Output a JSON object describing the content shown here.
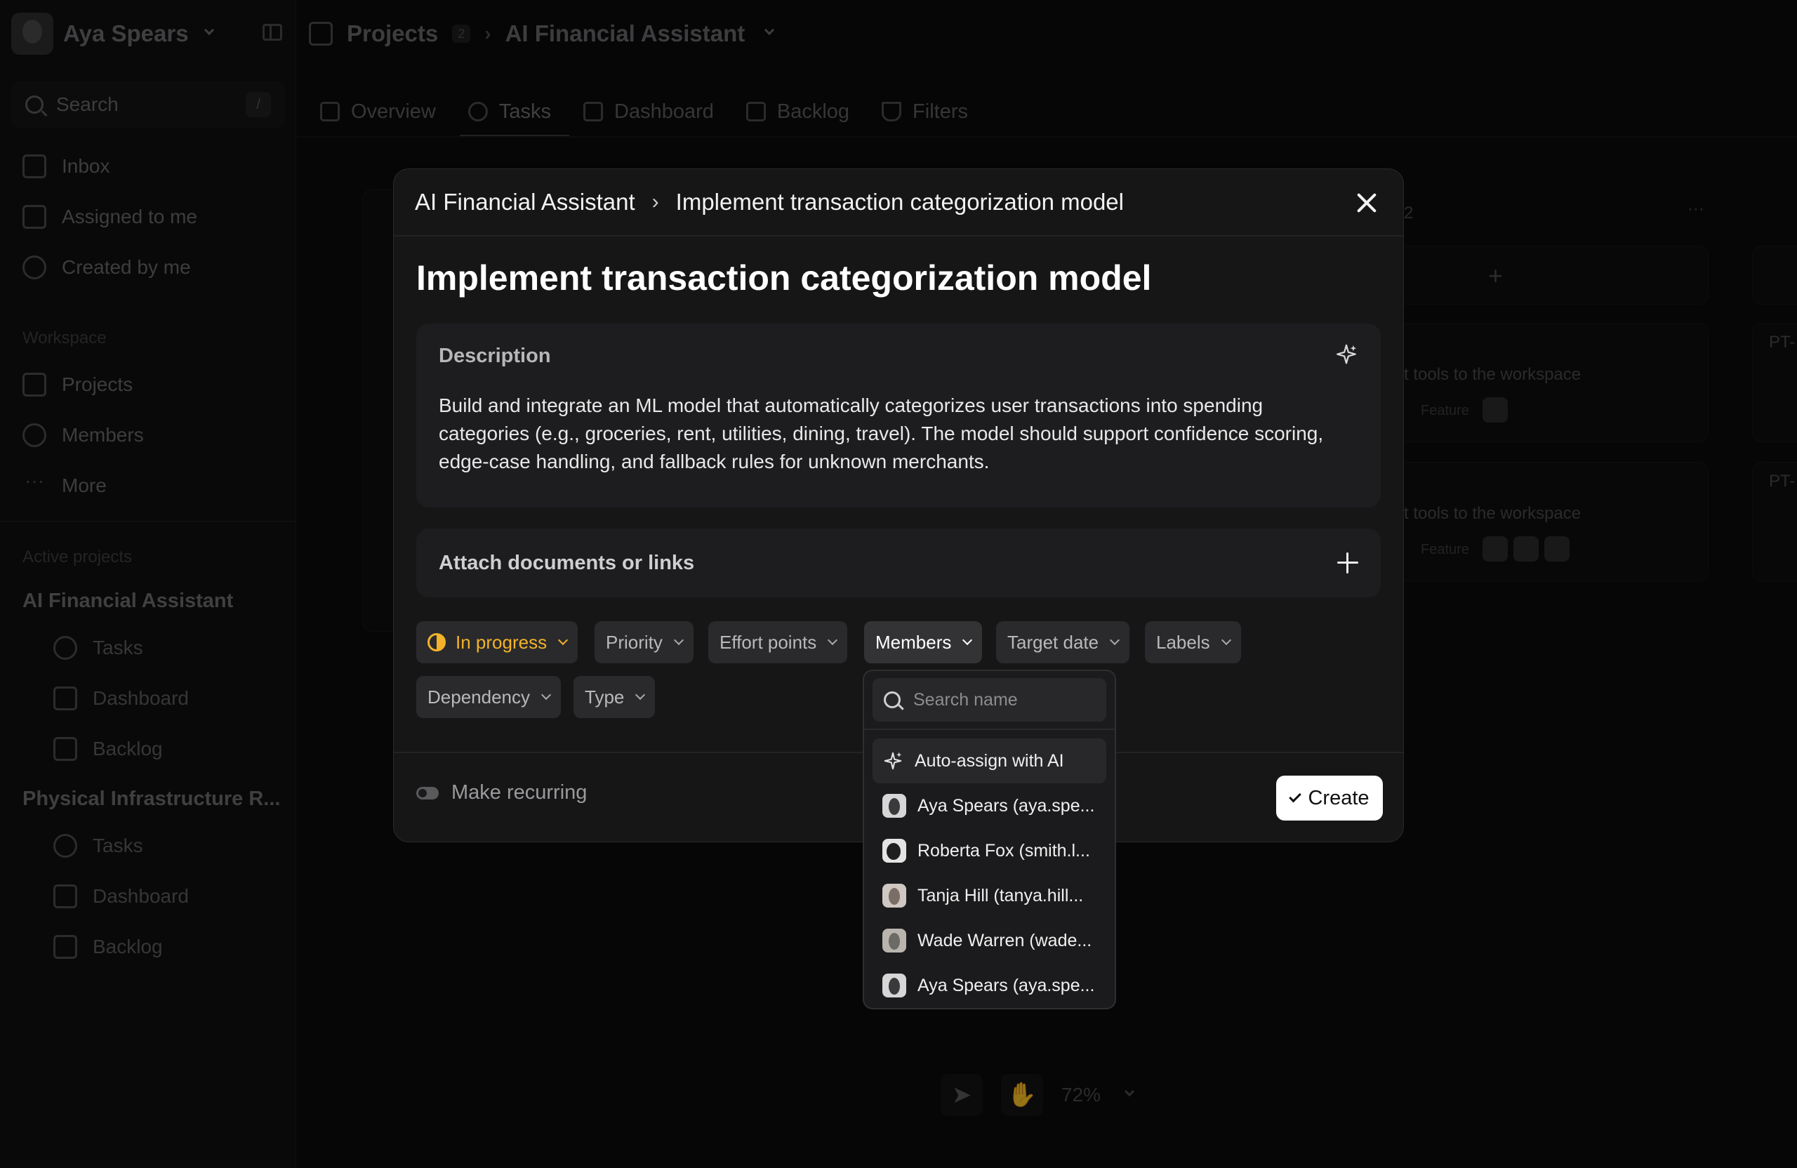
{
  "user": {
    "name": "Aya Spears"
  },
  "search": {
    "label": "Search",
    "shortcut": "/"
  },
  "nav": {
    "inbox": "Inbox",
    "assigned": "Assigned to me",
    "created": "Created by me"
  },
  "workspace": {
    "label": "Workspace",
    "projects": "Projects",
    "members": "Members",
    "more": "More"
  },
  "active_projects": {
    "label": "Active projects",
    "project1": {
      "name": "AI Financial Assistant",
      "tasks": "Tasks",
      "dashboard": "Dashboard",
      "backlog": "Backlog"
    },
    "project2": {
      "name": "Physical Infrastructure R...",
      "tasks": "Tasks",
      "dashboard": "Dashboard",
      "backlog": "Backlog"
    }
  },
  "topbar": {
    "projects": "Projects",
    "count": "2",
    "project": "AI Financial Assistant"
  },
  "tabs": {
    "overview": "Overview",
    "tasks": "Tasks",
    "dashboard": "Dashboard",
    "backlog": "Backlog",
    "filters": "Filters"
  },
  "board": {
    "card1": "t tools to the workspace",
    "card1_tag": "Feature",
    "card2": "t tools to the workspace",
    "card2_tag": "Feature",
    "col_count": "2",
    "pt1": "PT-",
    "pt2": "PT-"
  },
  "canvas": {
    "zoom": "72%"
  },
  "modal": {
    "breadcrumb_project": "AI Financial Assistant",
    "breadcrumb_task": "Implement transaction categorization model",
    "title": "Implement transaction categorization model",
    "description_label": "Description",
    "description_text": "Build and integrate an ML model that automatically categorizes user transactions into spending categories (e.g., groceries, rent, utilities, dining, travel). The model should support confidence scoring, edge-case handling, and fallback rules for unknown merchants.",
    "attach_label": "Attach documents or links",
    "properties": {
      "status": "In progress",
      "priority": "Priority",
      "effort": "Effort points",
      "members": "Members",
      "target_date": "Target date",
      "labels": "Labels",
      "dependency": "Dependency",
      "type": "Type"
    },
    "recurring_label": "Make recurring",
    "create_label": "Create"
  },
  "members_dropdown": {
    "search_placeholder": "Search name",
    "auto_assign": "Auto-assign with AI",
    "members": [
      "Aya Spears (aya.spe...",
      "Roberta Fox (smith.l...",
      "Tanja Hill (tanya.hill...",
      "Wade Warren (wade...",
      "Aya Spears (aya.spe..."
    ]
  },
  "colors": {
    "status_accent": "#f2b32a",
    "modal_bg": "#161617",
    "create_button_bg": "#ffffff"
  }
}
